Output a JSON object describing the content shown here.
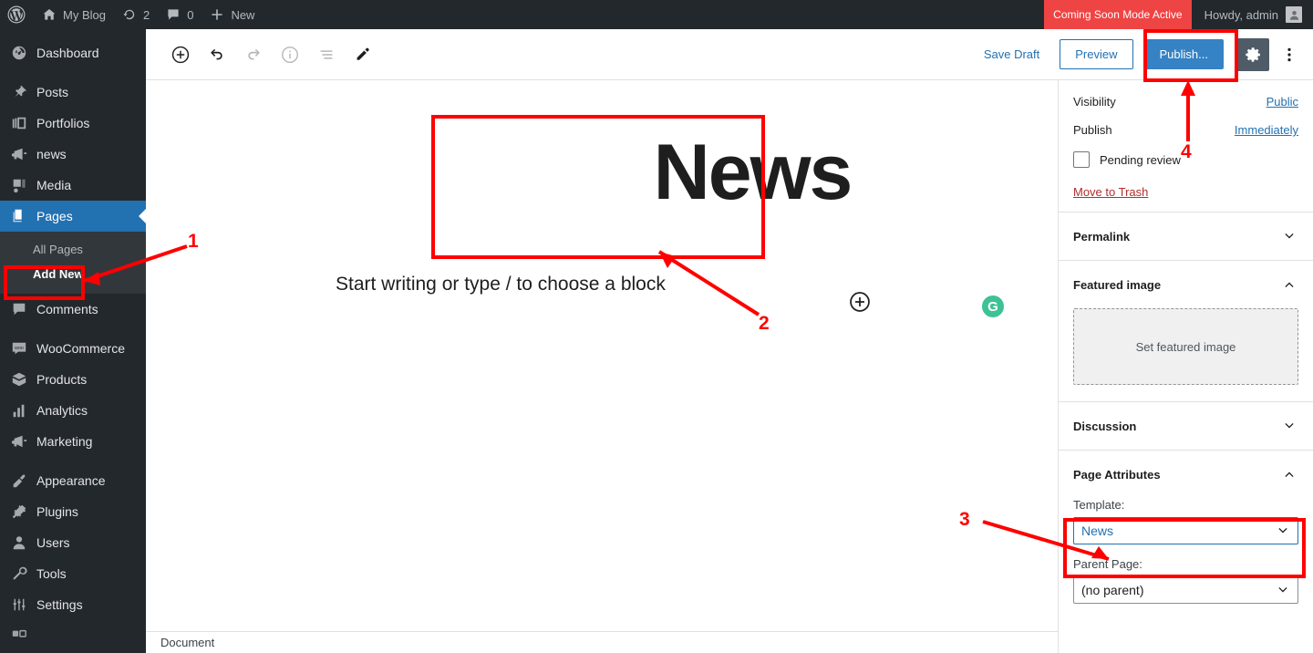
{
  "adminbar": {
    "site_name": "My Blog",
    "updates_count": "2",
    "comments_count": "0",
    "new_label": "New",
    "coming_soon": "Coming Soon Mode Active",
    "howdy": "Howdy, admin"
  },
  "sidebar": {
    "items": [
      {
        "label": "Dashboard",
        "icon": "dashboard-icon"
      },
      {
        "label": "Posts",
        "icon": "pin-icon"
      },
      {
        "label": "Portfolios",
        "icon": "portfolio-icon"
      },
      {
        "label": "news",
        "icon": "megaphone-icon"
      },
      {
        "label": "Media",
        "icon": "media-icon"
      },
      {
        "label": "Pages",
        "icon": "pages-icon",
        "active": true
      },
      {
        "label": "Comments",
        "icon": "comment-icon"
      },
      {
        "label": "WooCommerce",
        "icon": "woocommerce-icon"
      },
      {
        "label": "Products",
        "icon": "products-icon"
      },
      {
        "label": "Analytics",
        "icon": "analytics-icon"
      },
      {
        "label": "Marketing",
        "icon": "marketing-icon"
      },
      {
        "label": "Appearance",
        "icon": "appearance-icon"
      },
      {
        "label": "Plugins",
        "icon": "plugins-icon"
      },
      {
        "label": "Users",
        "icon": "users-icon"
      },
      {
        "label": "Tools",
        "icon": "tools-icon"
      },
      {
        "label": "Settings",
        "icon": "settings-icon"
      }
    ],
    "submenu": [
      {
        "label": "All Pages",
        "current": false
      },
      {
        "label": "Add New",
        "current": true
      }
    ]
  },
  "toolbar": {
    "add_block": "add-block-icon",
    "undo": "undo-icon",
    "redo": "redo-icon",
    "details": "info-icon",
    "list_view": "list-view-icon",
    "edit": "pencil-icon",
    "save_draft": "Save Draft",
    "preview": "Preview",
    "publish": "Publish...",
    "settings": "gear-icon",
    "more": "more-options-icon"
  },
  "editor": {
    "title": "News",
    "placeholder": "Start writing or type / to choose a block",
    "grammarly_badge": "G",
    "status_bar": "Document"
  },
  "panel": {
    "visibility_label": "Visibility",
    "visibility_value": "Public",
    "publish_label": "Publish",
    "publish_value": "Immediately",
    "pending_review": "Pending review",
    "move_to_trash": "Move to Trash",
    "permalink": "Permalink",
    "featured_image": "Featured image",
    "set_featured_image": "Set featured image",
    "discussion": "Discussion",
    "page_attributes": "Page Attributes",
    "template_label": "Template:",
    "template_value": "News",
    "parent_label": "Parent Page:",
    "parent_value": "(no parent)"
  },
  "annotations": {
    "one": "1",
    "two": "2",
    "three": "3",
    "four": "4"
  },
  "colors": {
    "admin_bar": "#23282d",
    "accent_blue": "#2271b1",
    "publish_blue": "#3582c4",
    "annotation_red": "#ff0000",
    "coming_soon_red": "#ef4444",
    "grammarly_green": "#3ec195",
    "trash_red": "#b32d2e"
  }
}
